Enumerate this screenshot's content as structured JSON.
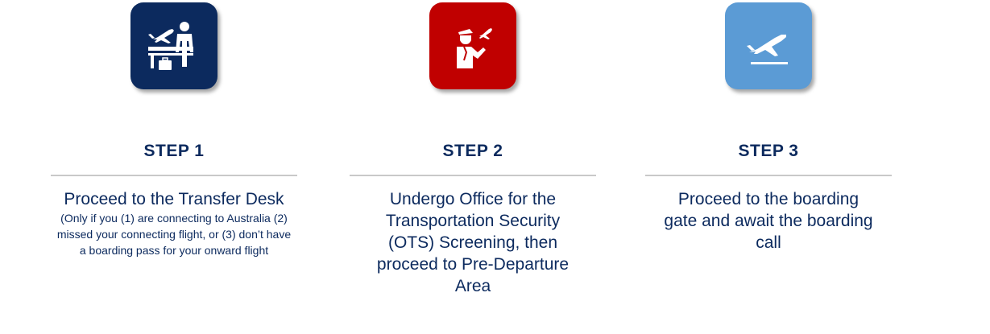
{
  "colors": {
    "step1_tile": "#0c2a5e",
    "step2_tile": "#c00000",
    "step3_tile": "#5b9bd5",
    "text": "#0c2a5e",
    "divider": "#c9c9c9"
  },
  "steps": [
    {
      "title": "STEP 1",
      "icon": "transfer-desk-icon",
      "description": "Proceed to the Transfer Desk",
      "note": "(Only if you (1) are connecting to Australia (2) missed your connecting flight, or (3) don’t have a boarding pass for your onward flight"
    },
    {
      "title": "STEP 2",
      "icon": "security-screening-icon",
      "description": "Undergo Office for the Transportation Security (OTS) Screening, then proceed to Pre-Departure Area"
    },
    {
      "title": "STEP 3",
      "icon": "departure-plane-icon",
      "description": "Proceed to the boarding gate and await the boarding call"
    }
  ]
}
